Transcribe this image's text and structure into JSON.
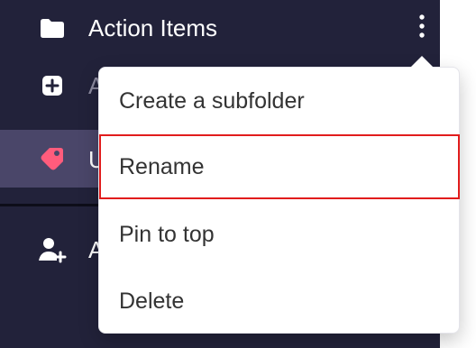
{
  "sidebar": {
    "items": [
      {
        "label": "Action Items",
        "icon": "folder-icon",
        "color": "#ffffff"
      },
      {
        "label": "A",
        "icon": "add-folder-icon",
        "color": "#8d8ba0"
      },
      {
        "label": "U",
        "icon": "tag-icon",
        "color": "#ffffff",
        "icon_color": "#ff5c7c"
      },
      {
        "label": "A",
        "icon": "add-user-icon",
        "color": "#ffffff"
      }
    ],
    "colors": {
      "background": "#22223a",
      "active_row": "#4a4669",
      "divider": "#0d0d19"
    }
  },
  "context_menu": {
    "items": [
      {
        "label": "Create a subfolder"
      },
      {
        "label": "Rename",
        "highlighted": true
      },
      {
        "label": "Pin to top"
      },
      {
        "label": "Delete"
      }
    ],
    "highlight_color": "#e11c1c",
    "text_color": "#333333"
  },
  "more_button": {
    "icon": "more-vertical-icon"
  }
}
